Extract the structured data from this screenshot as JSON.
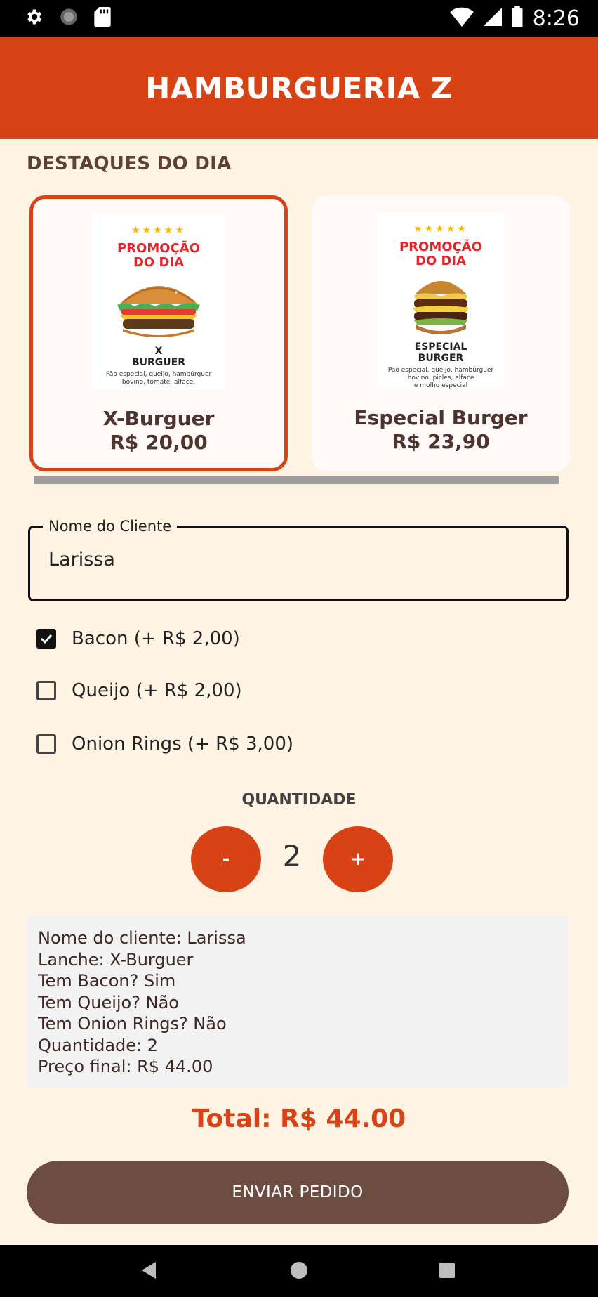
{
  "status_bar": {
    "time": "8:26",
    "left_icons": [
      "gear-icon",
      "circle-loading-icon",
      "sd-card-icon"
    ],
    "right_icons": [
      "wifi-icon",
      "signal-icon",
      "battery-icon"
    ]
  },
  "app_bar": {
    "title": "HAMBURGUERIA Z"
  },
  "highlights": {
    "title": "DESTAQUES DO DIA",
    "items": [
      {
        "name": "X-Burguer",
        "price": "R$ 20,00",
        "selected": true,
        "poster": {
          "stars": "★★★★★",
          "promo_line1": "PROMOÇÃO",
          "promo_line2": "DO DIA",
          "burger_line1": "X",
          "burger_line2": "BURGUER",
          "desc_line1": "Pão especial, queijo, hambúrguer",
          "desc_line2": "bovino, tomate, alface."
        }
      },
      {
        "name": "Especial Burger",
        "price": "R$ 23,90",
        "selected": false,
        "poster": {
          "stars": "★★★★★",
          "promo_line1": "PROMOÇÃO",
          "promo_line2": "DO DIA",
          "burger_line1": "ESPECIAL",
          "burger_line2": "BURGER",
          "desc_line1": "Pão especial, queijo, hambúrguer",
          "desc_line2": "bovino, picles, alface",
          "desc_line3": "e molho especial"
        }
      }
    ]
  },
  "customer_field": {
    "label": "Nome do Cliente",
    "value": "Larissa"
  },
  "extras": [
    {
      "label": "Bacon (+ R$ 2,00)",
      "checked": true
    },
    {
      "label": "Queijo (+ R$ 2,00)",
      "checked": false
    },
    {
      "label": "Onion Rings (+ R$ 3,00)",
      "checked": false
    }
  ],
  "quantity": {
    "title": "QUANTIDADE",
    "value": "2",
    "minus_label": "-",
    "plus_label": "+"
  },
  "summary": {
    "lines": [
      "Nome do cliente: Larissa",
      "Lanche: X-Burguer",
      "Tem Bacon? Sim",
      "Tem Queijo? Não",
      "Tem Onion Rings? Não",
      "Quantidade: 2",
      "Preço final: R$ 44.00"
    ]
  },
  "total": "Total: R$ 44.00",
  "send_button": "ENVIAR PEDIDO",
  "colors": {
    "primary": "#D84315",
    "background": "#FFF3E3",
    "button_brown": "#6D4C41",
    "summary_bg": "#F2F2F2"
  }
}
